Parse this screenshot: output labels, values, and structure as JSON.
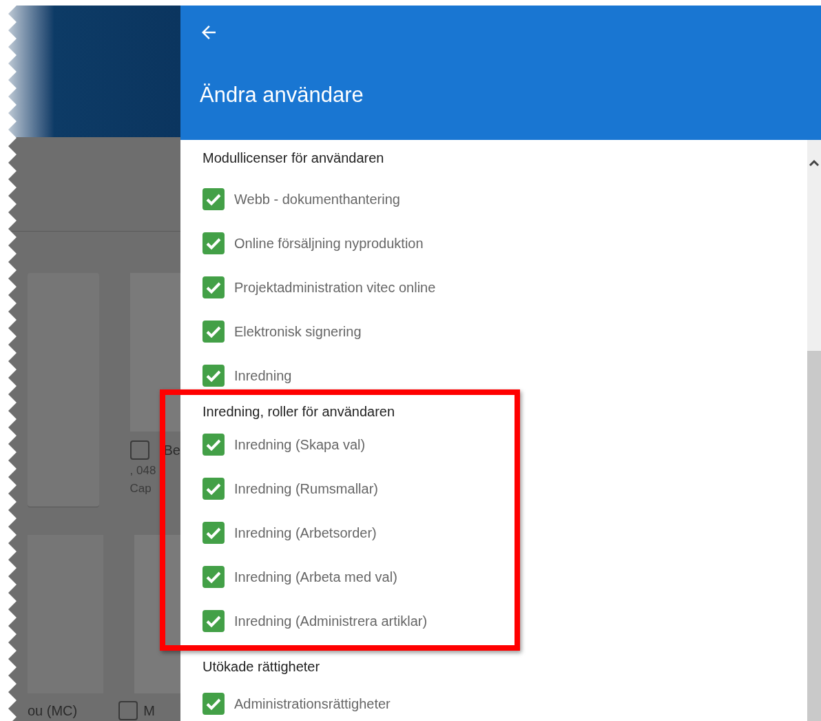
{
  "background": {
    "card_texts": [
      {
        "text": "Be"
      },
      {
        "text": ", 048"
      },
      {
        "text": "Cap"
      }
    ],
    "bottom_texts": [
      {
        "text": "ou (MC)"
      },
      {
        "text": "M"
      }
    ],
    "checkboxes": [
      {
        "checked": false
      },
      {
        "checked": false
      }
    ]
  },
  "panel": {
    "title": "Ändra användare",
    "sections": [
      {
        "title": "Modullicenser för användaren",
        "highlighted": false,
        "items": [
          {
            "label": "Webb - dokumenthantering",
            "checked": true
          },
          {
            "label": "Online försäljning nyproduktion",
            "checked": true
          },
          {
            "label": "Projektadministration vitec online",
            "checked": true
          },
          {
            "label": "Elektronisk signering",
            "checked": true
          },
          {
            "label": "Inredning",
            "checked": true
          }
        ]
      },
      {
        "title": "Inredning, roller för användaren",
        "highlighted": true,
        "items": [
          {
            "label": "Inredning (Skapa val)",
            "checked": true
          },
          {
            "label": "Inredning (Rumsmallar)",
            "checked": true
          },
          {
            "label": "Inredning (Arbetsorder)",
            "checked": true
          },
          {
            "label": "Inredning (Arbeta med val)",
            "checked": true
          },
          {
            "label": "Inredning (Administrera artiklar)",
            "checked": true
          }
        ]
      },
      {
        "title": "Utökade rättigheter",
        "highlighted": false,
        "items": [
          {
            "label": "Administrationsrättigheter",
            "checked": true
          }
        ]
      }
    ]
  }
}
